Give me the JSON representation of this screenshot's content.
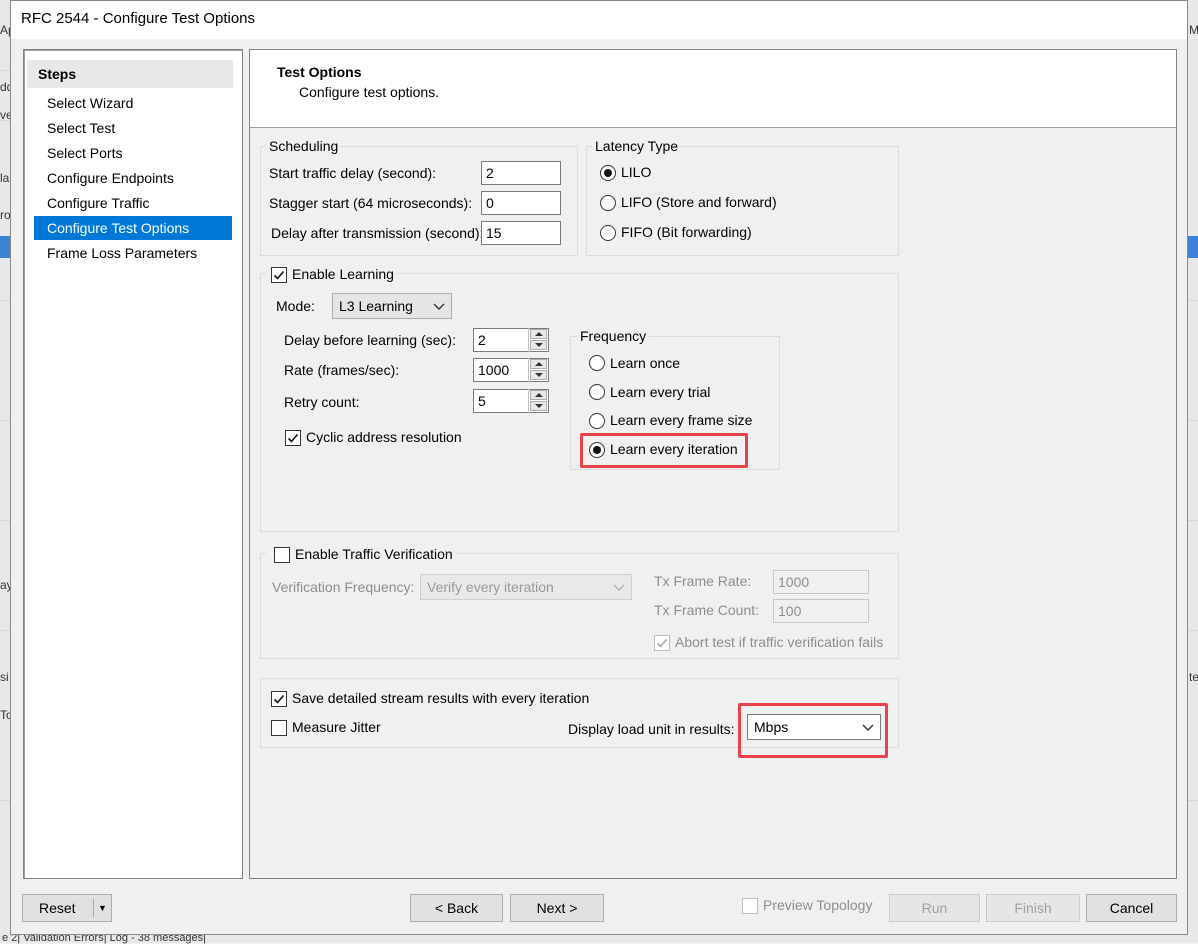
{
  "window": {
    "title": "RFC 2544 - Configure Test Options"
  },
  "background": {
    "left_stubs": [
      "Ap",
      "dd",
      "ve",
      "la",
      "ro",
      "ay",
      "si",
      "To"
    ],
    "right_stubs": [
      "M",
      "te"
    ],
    "status_text": "e 2| Validation Errors| Log - 38 messages|"
  },
  "steps": {
    "heading": "Steps",
    "items": [
      {
        "label": "Select Wizard"
      },
      {
        "label": "Select Test"
      },
      {
        "label": "Select Ports"
      },
      {
        "label": "Configure Endpoints"
      },
      {
        "label": "Configure Traffic"
      },
      {
        "label": "Configure Test Options",
        "selected": true
      },
      {
        "label": "Frame Loss Parameters"
      }
    ]
  },
  "header": {
    "title": "Test Options",
    "subtitle": "Configure test options."
  },
  "scheduling": {
    "legend": "Scheduling",
    "start_delay_label": "Start traffic delay (second):",
    "start_delay_value": "2",
    "stagger_label": "Stagger start (64 microseconds):",
    "stagger_value": "0",
    "delay_after_label": "Delay after transmission (second):",
    "delay_after_value": "15"
  },
  "latency": {
    "legend": "Latency Type",
    "options": [
      "LILO",
      "LIFO (Store and forward)",
      "FIFO (Bit forwarding)"
    ],
    "selected": "LILO"
  },
  "learning": {
    "enable_label": "Enable Learning",
    "enabled": true,
    "mode_label": "Mode:",
    "mode_value": "L3 Learning",
    "delay_label": "Delay before learning (sec):",
    "delay_value": "2",
    "rate_label": "Rate (frames/sec):",
    "rate_value": "1000",
    "retry_label": "Retry count:",
    "retry_value": "5",
    "cyclic_label": "Cyclic address resolution",
    "cyclic_checked": true,
    "frequency": {
      "legend": "Frequency",
      "options": [
        "Learn once",
        "Learn every trial",
        "Learn every frame size",
        "Learn every iteration"
      ],
      "selected": "Learn every iteration"
    }
  },
  "verification": {
    "enable_label": "Enable Traffic Verification",
    "enabled": false,
    "freq_label": "Verification Frequency:",
    "freq_value": "Verify every iteration",
    "tx_rate_label": "Tx Frame Rate:",
    "tx_rate_value": "1000",
    "tx_count_label": "Tx Frame Count:",
    "tx_count_value": "100",
    "abort_label": "Abort test if traffic verification fails",
    "abort_checked": true
  },
  "results": {
    "save_label": "Save detailed stream results with every iteration",
    "save_checked": true,
    "jitter_label": "Measure Jitter",
    "jitter_checked": false,
    "load_unit_label": "Display load unit in results:",
    "load_unit_value": "Mbps"
  },
  "footer": {
    "reset": "Reset",
    "back": "< Back",
    "next": "Next >",
    "preview": "Preview Topology",
    "run": "Run",
    "finish": "Finish",
    "cancel": "Cancel"
  },
  "colors": {
    "selection": "#0078d7",
    "highlight": "#e8424a"
  }
}
